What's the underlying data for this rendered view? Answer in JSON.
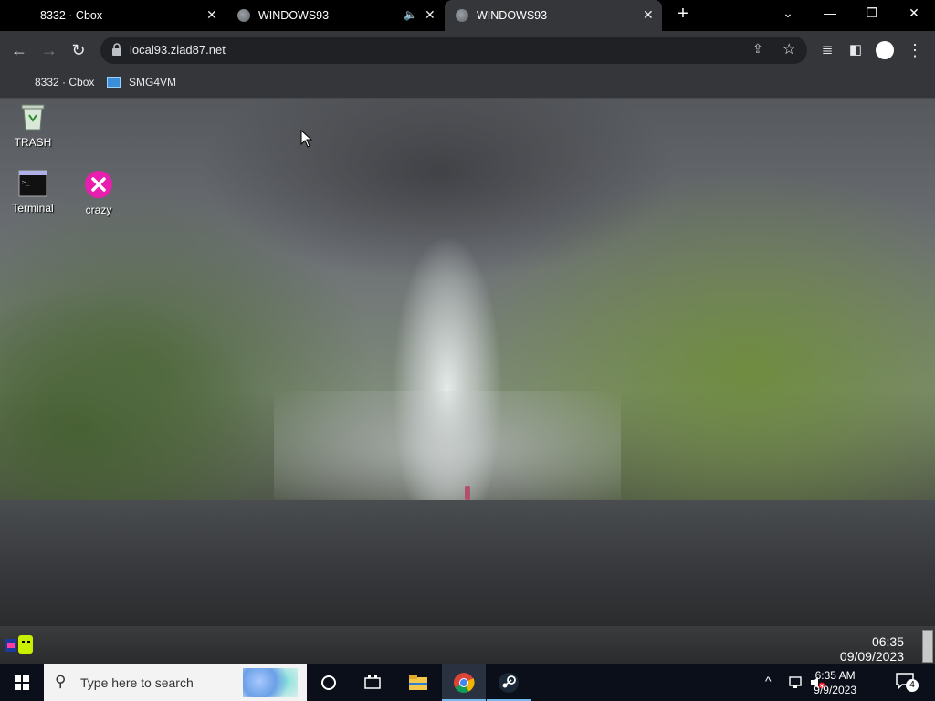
{
  "tabs": [
    {
      "title": "8332 · Cbox"
    },
    {
      "title": "WINDOWS93"
    },
    {
      "title": "WINDOWS93"
    }
  ],
  "address": {
    "url": "local93.ziad87.net"
  },
  "bookmarks": [
    {
      "label": "8332 · Cbox"
    },
    {
      "label": "SMG4VM"
    }
  ],
  "desktop_icons": [
    {
      "label": "TRASH",
      "icon": "trash-icon"
    },
    {
      "label": "Terminal",
      "icon": "terminal-icon"
    },
    {
      "label": "crazy",
      "icon": "crazy-icon"
    }
  ],
  "w93_clock": {
    "time": "06:35",
    "date": "09/09/2023"
  },
  "taskbar": {
    "search_placeholder": "Type here to search",
    "time": "6:35 AM",
    "date": "9/9/2023",
    "notifications": "4"
  },
  "colors": {
    "accent": "#1a73e8",
    "tab_bg": "#35363a",
    "crazy_icon": "#e81eae"
  }
}
